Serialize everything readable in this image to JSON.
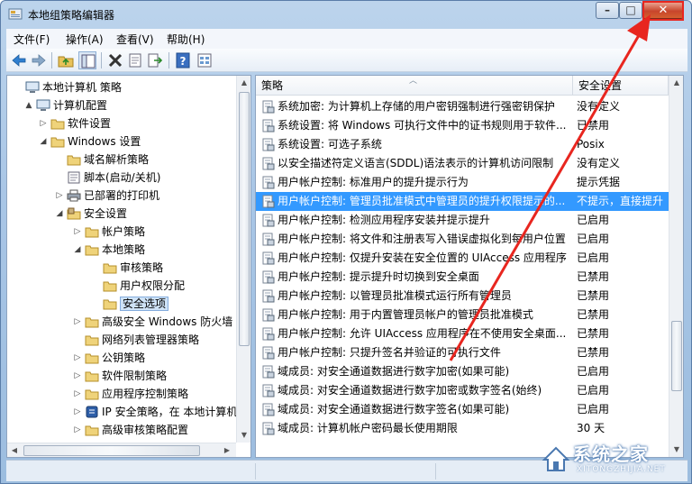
{
  "window": {
    "title": "本地组策略编辑器",
    "caption": {
      "minimize": "–",
      "maximize": "□",
      "close": "✕"
    }
  },
  "menu": [
    "文件(F)",
    "操作(A)",
    "查看(V)",
    "帮助(H)"
  ],
  "toolbar_icons": [
    "back-icon",
    "forward-icon",
    "up-folder-icon",
    "show-hide-tree-icon",
    "delete-icon",
    "properties-icon",
    "export-icon",
    "help-icon",
    "view-icon"
  ],
  "tree": [
    {
      "label": "本地计算机 策略",
      "level": 0,
      "expand": "",
      "icon": "computer"
    },
    {
      "label": "计算机配置",
      "level": 1,
      "expand": "▲",
      "icon": "computer"
    },
    {
      "label": "软件设置",
      "level": 2,
      "expand": "▷",
      "icon": "folder"
    },
    {
      "label": "Windows 设置",
      "level": 2,
      "expand": "◢",
      "icon": "folder"
    },
    {
      "label": "域名解析策略",
      "level": 3,
      "expand": "",
      "icon": "folder"
    },
    {
      "label": "脚本(启动/关机)",
      "level": 3,
      "expand": "",
      "icon": "script"
    },
    {
      "label": "已部署的打印机",
      "level": 3,
      "expand": "▷",
      "icon": "printer"
    },
    {
      "label": "安全设置",
      "level": 3,
      "expand": "◢",
      "icon": "security"
    },
    {
      "label": "帐户策略",
      "level": 4,
      "expand": "▷",
      "icon": "folder"
    },
    {
      "label": "本地策略",
      "level": 4,
      "expand": "◢",
      "icon": "folder"
    },
    {
      "label": "审核策略",
      "level": 5,
      "expand": "",
      "icon": "folder"
    },
    {
      "label": "用户权限分配",
      "level": 5,
      "expand": "",
      "icon": "folder"
    },
    {
      "label": "安全选项",
      "level": 5,
      "expand": "",
      "icon": "folder",
      "selected": true
    },
    {
      "label": "高级安全 Windows 防火墙",
      "level": 4,
      "expand": "▷",
      "icon": "folder"
    },
    {
      "label": "网络列表管理器策略",
      "level": 4,
      "expand": "",
      "icon": "folder"
    },
    {
      "label": "公钥策略",
      "level": 4,
      "expand": "▷",
      "icon": "folder"
    },
    {
      "label": "软件限制策略",
      "level": 4,
      "expand": "▷",
      "icon": "folder"
    },
    {
      "label": "应用程序控制策略",
      "level": 4,
      "expand": "▷",
      "icon": "folder"
    },
    {
      "label": "IP 安全策略，在 本地计算机",
      "level": 4,
      "expand": "▷",
      "icon": "ipsec"
    },
    {
      "label": "高级审核策略配置",
      "level": 4,
      "expand": "▷",
      "icon": "folder"
    }
  ],
  "list": {
    "headers": {
      "policy": "策略",
      "setting": "安全设置"
    },
    "rows": [
      {
        "policy": "系统加密: 为计算机上存储的用户密钥强制进行强密钥保护",
        "setting": "没有定义"
      },
      {
        "policy": "系统设置: 将 Windows 可执行文件中的证书规则用于软件...",
        "setting": "已禁用"
      },
      {
        "policy": "系统设置: 可选子系统",
        "setting": "Posix"
      },
      {
        "policy": "以安全描述符定义语言(SDDL)语法表示的计算机访问限制",
        "setting": "没有定义"
      },
      {
        "policy": "用户帐户控制: 标准用户的提升提示行为",
        "setting": "提示凭据"
      },
      {
        "policy": "用户帐户控制: 管理员批准模式中管理员的提升权限提示的...",
        "setting": "不提示，直接提升",
        "selected": true
      },
      {
        "policy": "用户帐户控制: 检测应用程序安装并提示提升",
        "setting": "已启用"
      },
      {
        "policy": "用户帐户控制: 将文件和注册表写入错误虚拟化到每用户位置",
        "setting": "已启用"
      },
      {
        "policy": "用户帐户控制: 仅提升安装在安全位置的 UIAccess 应用程序",
        "setting": "已启用"
      },
      {
        "policy": "用户帐户控制: 提示提升时切换到安全桌面",
        "setting": "已禁用"
      },
      {
        "policy": "用户帐户控制: 以管理员批准模式运行所有管理员",
        "setting": "已禁用"
      },
      {
        "policy": "用户帐户控制: 用于内置管理员帐户的管理员批准模式",
        "setting": "已禁用"
      },
      {
        "policy": "用户帐户控制: 允许 UIAccess 应用程序在不使用安全桌面...",
        "setting": "已禁用"
      },
      {
        "policy": "用户帐户控制: 只提升签名并验证的可执行文件",
        "setting": "已禁用"
      },
      {
        "policy": "域成员: 对安全通道数据进行数字加密(如果可能)",
        "setting": "已启用"
      },
      {
        "policy": "域成员: 对安全通道数据进行数字加密或数字签名(始终)",
        "setting": "已启用"
      },
      {
        "policy": "域成员: 对安全通道数据进行数字签名(如果可能)",
        "setting": "已启用"
      },
      {
        "policy": "域成员: 计算机帐户密码最长使用期限",
        "setting": "30 天"
      }
    ]
  },
  "watermark": {
    "text": "系统之家",
    "sub": "XITONGZHIJIA.NET"
  },
  "colors": {
    "selection": "#3399ff",
    "annotation": "#e8261f"
  }
}
